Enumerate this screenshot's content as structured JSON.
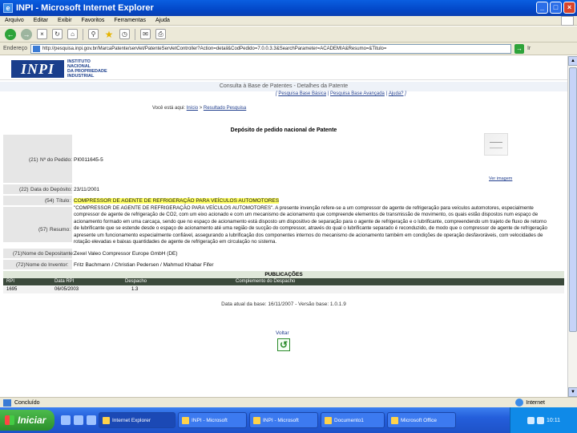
{
  "window": {
    "title": "INPI - Microsoft Internet Explorer",
    "app_icon": "e",
    "minimize": "_",
    "maximize": "□",
    "close": "×"
  },
  "menu": [
    "Arquivo",
    "Editar",
    "Exibir",
    "Favoritos",
    "Ferramentas",
    "Ajuda"
  ],
  "toolbar": {
    "back": "←",
    "forward": "→",
    "stop": "×",
    "refresh": "↻",
    "home": "⌂",
    "search": "⚲",
    "favorites": "★",
    "history": "◷",
    "mail": "✉",
    "print": "⎙"
  },
  "address": {
    "label": "Endereço",
    "url": "http://pesquisa.inpi.gov.br/MarcaPatente/servlet/PatenteServletController?Action=detail&CodPedido=7.0.0.3.3&SearchParameter=ACADEMIA&Resumo=&Titulo=",
    "go": "→",
    "links_label": "Ir"
  },
  "site": {
    "logo_text": "INPI",
    "institute_name": [
      "INSTITUTO",
      "NACIONAL",
      "DA PROPRIEDADE",
      "INDUSTRIAL"
    ],
    "subtitle": "Consulta à Base de Patentes - Detalhes da Patente",
    "search_links": {
      "open": "[ ",
      "basic": "Pesquisa Base Básica",
      "separator": " | ",
      "advanced": "Pesquisa Base Avançada",
      "help": "Ajuda?",
      "close": " ]"
    },
    "breadcrumb": {
      "prefix": "Você está aqui: ",
      "link": "Início",
      "separator": " > ",
      "current": "Resultado Pesquisa"
    },
    "heading": "Depósito de pedido nacional de Patente",
    "thumbnail_link": "Ver imagem"
  },
  "patent": {
    "fields": [
      {
        "code": "(21)",
        "label": "Nº do Pedido:",
        "value": "PI0011645-5"
      },
      {
        "code": "(22)",
        "label": "Data do Depósito:",
        "value": "23/11/2001"
      },
      {
        "code": "(54)",
        "label": "Título:",
        "value": "COMPRESSOR DE AGENTE DE REFRIGERAÇÃO PARA VEÍCULOS AUTOMOTORES"
      },
      {
        "code": "(57)",
        "label": "Resumo:",
        "value": ""
      },
      {
        "code": "(71)",
        "label": "Nome do Depositante:",
        "value": "Zexel Valeo Compressor Europe GmbH (DE)"
      },
      {
        "code": "(72)",
        "label": "Nome do Inventor:",
        "value": "Fritz Bachmann / Christian Pedersen / Mahmud Khabar Fifer"
      }
    ],
    "abstract": "\"COMPRESSOR DE AGENTE DE REFRIGERAÇÃO PARA VEÍCULOS AUTOMOTORES\". A presente invenção refere-se a um compressor de agente de refrigeração para veículos automotores, especialmente compressor de agente de refrigeração de CO2, com um eixo acionado e com um mecanismo de acionamento que compreende elementos de transmissão de movimento, os quais estão dispostos num espaço de acionamento formado em uma carcaça, sendo que no espaço de acionamento está disposto um dispositivo de separação para o agente de refrigeração e o lubrificante, compreendendo um trajeto de fluxo de retorno de lubrificante que se estende desde o espaço de acionamento até uma região de sucção do compressor, através do qual o lubrificante separado é reconduzido, de modo que o compressor de agente de refrigeração apresente um funcionamento especialmente confiável, assegurando a lubrificação dos componentes internos do mecanismo de acionamento também em condições de operação desfavoráveis, com velocidades de rotação elevadas e baixas quantidades de agente de refrigeração em circulação no sistema."
  },
  "publications": {
    "title": "PUBLICAÇÕES",
    "columns": [
      "RPI",
      "Data RPI",
      "Despacho",
      "Complemento do Despacho"
    ],
    "rows": [
      {
        "rpi": "1695",
        "date": "06/05/2003",
        "dispatch": "1.3",
        "complement": ""
      }
    ]
  },
  "footer": {
    "date_line": "Data atual da base: 16/11/2007 - Versão base: 1.0.1.9",
    "back_label": "Voltar",
    "back_icon": "↺"
  },
  "status": {
    "text": "Concluído",
    "zone": "Internet"
  },
  "taskbar": {
    "start": "Iniciar",
    "items": [
      {
        "label": "Internet Explorer",
        "active": true
      },
      {
        "label": "INPI - Microsoft",
        "active": false
      },
      {
        "label": "INPI - Microsoft",
        "active": false
      },
      {
        "label": "Documento1",
        "active": false
      },
      {
        "label": "Microsoft Office",
        "active": false
      }
    ],
    "clock": "10:11"
  }
}
